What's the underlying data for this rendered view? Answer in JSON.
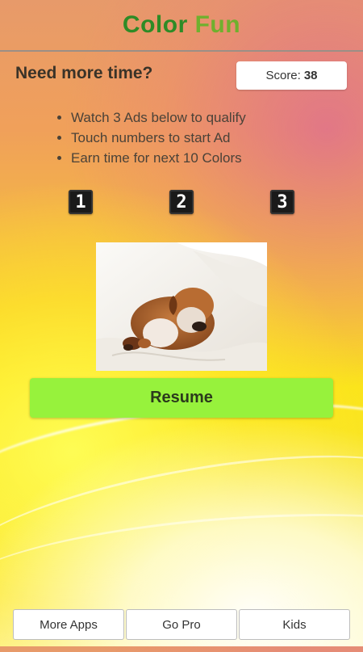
{
  "app": {
    "title_part1": "Color ",
    "title_part2": "Fun"
  },
  "main": {
    "heading": "Need more time?",
    "score": {
      "label": "Score:",
      "value": "38"
    },
    "instructions": [
      "Watch 3 Ads below to qualify",
      "Touch numbers to start Ad",
      "Earn time for next 10 Colors"
    ],
    "ad_buttons": [
      "1",
      "2",
      "3"
    ],
    "resume_label": "Resume"
  },
  "bottom_bar": {
    "more_apps": "More Apps",
    "go_pro": "Go Pro",
    "kids": "Kids"
  },
  "colors": {
    "title_green": "#2e8b26",
    "title_light_green": "#6fb02e",
    "resume_green": "#97f23c"
  },
  "icons": {
    "ad_number_tiles": "number-tile-icon",
    "photo": "sleeping-puppy-image"
  }
}
